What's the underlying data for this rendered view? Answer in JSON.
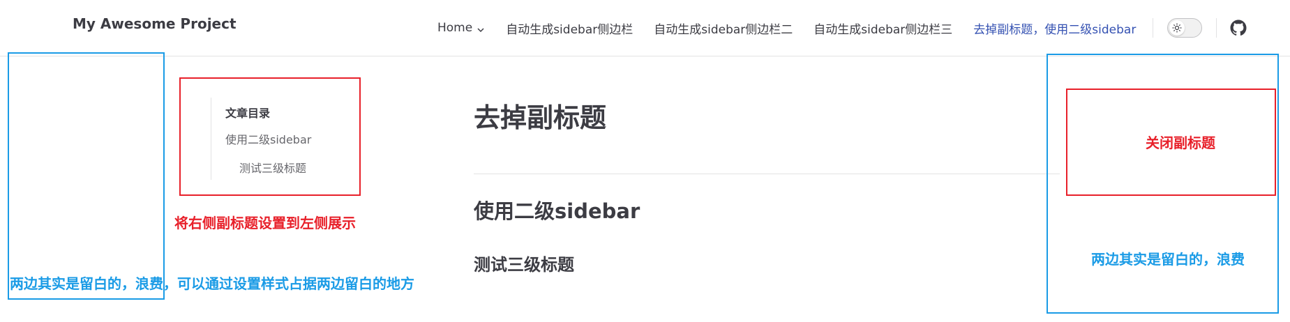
{
  "navbar": {
    "site_title": "My Awesome Project",
    "items": [
      {
        "label": "Home"
      },
      {
        "label": "自动生成sidebar侧边栏"
      },
      {
        "label": "自动生成sidebar侧边栏二"
      },
      {
        "label": "自动生成sidebar侧边栏三"
      },
      {
        "label": "去掉副标题，使用二级sidebar"
      }
    ],
    "active_color": "#3451b2",
    "icons": [
      "chevron-down-icon",
      "sun-icon",
      "github-icon"
    ]
  },
  "outline": {
    "title": "文章目录",
    "links": [
      {
        "label": "使用二级sidebar"
      },
      {
        "label": "测试三级标题"
      }
    ]
  },
  "content": {
    "h1": "去掉副标题",
    "h2": "使用二级sidebar",
    "h3": "测试三级标题"
  },
  "annotations": {
    "left_note_red": "将右侧副标题设置到左侧展示",
    "left_note_blue": "两边其实是留白的，浪费，可以通过设置样式占据两边留白的地方",
    "right_note_red": "关闭副标题",
    "right_note_blue": "两边其实是留白的，浪费",
    "colors": {
      "red": "#e8202a",
      "blue": "#1a9be6"
    }
  }
}
